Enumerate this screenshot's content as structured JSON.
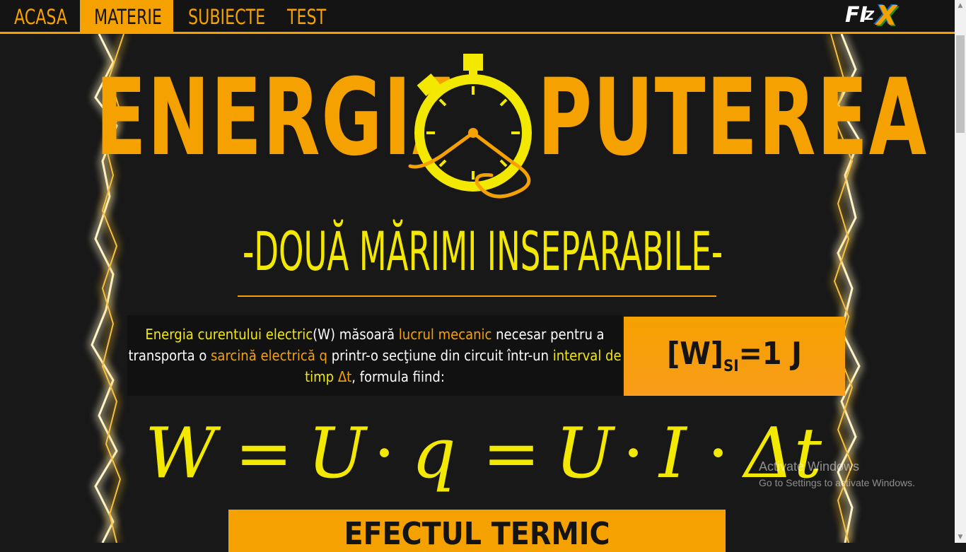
{
  "nav": {
    "items": [
      {
        "label": "ACASA"
      },
      {
        "label": "MATERIE"
      },
      {
        "label": "SUBIECTE"
      },
      {
        "label": "TEST"
      }
    ],
    "active_index": 1
  },
  "logo": {
    "part1": "FI",
    "part2": "Z",
    "part3": "X"
  },
  "title": {
    "left": "ENERGIA",
    "right": "PUTEREA",
    "icon": "stopwatch-icon"
  },
  "subtitle": "-DOUĂ MĂRIMI INSEPARABILE-",
  "description": {
    "p1": "Energia curentului electric",
    "p2": "(W) măsoară ",
    "p3": "lucrul mecanic",
    "p4": " necesar pentru a transporta o ",
    "p5": "sarcină electrică",
    "p6": " q",
    "p7": " printr-o secţiune din circuit într-un ",
    "p8": "interval de timp",
    "p9": " Δt",
    "p10": ", formula fiind:"
  },
  "unit": {
    "main": "[W]",
    "sub": "SI",
    "rest": "=1 J"
  },
  "formula": {
    "tokens": [
      "W",
      "=",
      "U",
      "·",
      "q",
      "=",
      "U",
      "·",
      "I",
      "·",
      "Δt"
    ]
  },
  "section_heading": "EFECTUL TERMIC",
  "watermark": {
    "title": "Activate Windows",
    "sub": "Go to Settings to activate Windows."
  },
  "colors": {
    "accent": "#f5a100",
    "yellow": "#f3e800",
    "background": "#181818"
  }
}
